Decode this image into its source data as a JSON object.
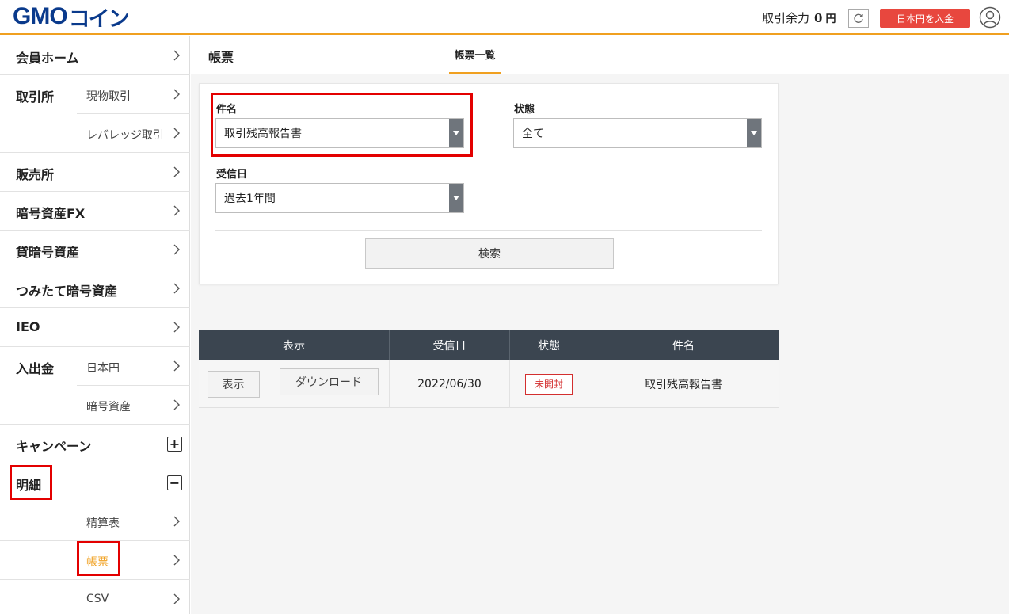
{
  "header": {
    "logo_latin": "GMO",
    "logo_kana": "コイン",
    "balance_label": "取引余力",
    "balance_value": "0",
    "balance_unit": "円",
    "deposit_button": "日本円を入金",
    "accent_color": "#f0a020",
    "deposit_color": "#e8473e"
  },
  "sidebar": {
    "member_home": "会員ホーム",
    "exchange": "取引所",
    "exchange_spot": "現物取引",
    "exchange_leverage": "レバレッジ取引",
    "sales": "販売所",
    "crypto_fx": "暗号資産FX",
    "lending": "貸暗号資産",
    "tsumitate": "つみたて暗号資産",
    "ieo": "IEO",
    "deposit_withdraw": "入出金",
    "dw_jpy": "日本円",
    "dw_crypto": "暗号資産",
    "campaign": "キャンペーン",
    "statement": "明細",
    "statement_settlement": "精算表",
    "statement_report": "帳票",
    "statement_csv": "CSV"
  },
  "main": {
    "title": "帳票",
    "tab_list": "帳票一覧",
    "form": {
      "subject_label": "件名",
      "subject_value": "取引残高報告書",
      "status_label": "状態",
      "status_value": "全て",
      "received_label": "受信日",
      "received_value": "過去1年間",
      "search_button": "検索"
    },
    "table": {
      "headers": [
        "表示",
        "受信日",
        "状態",
        "件名"
      ],
      "rows": [
        {
          "view_button": "表示",
          "download_button": "ダウンロード",
          "date": "2022/06/30",
          "status": "未開封",
          "subject": "取引残高報告書"
        }
      ]
    }
  }
}
